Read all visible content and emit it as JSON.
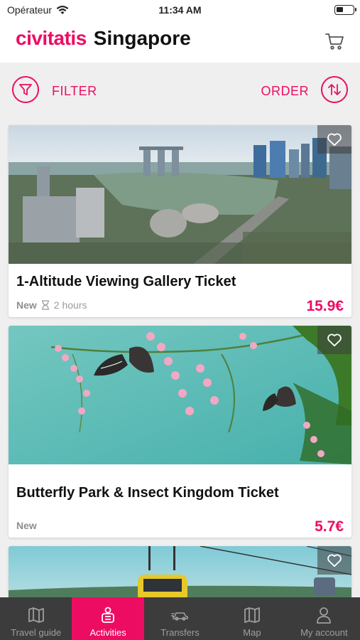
{
  "status_bar": {
    "carrier": "Opérateur",
    "time": "11:34 AM"
  },
  "header": {
    "logo": "civitatis",
    "city": "Singapore"
  },
  "toolbar": {
    "filter_label": "FILTER",
    "order_label": "ORDER"
  },
  "activities": [
    {
      "title": "1-Altitude Viewing Gallery Ticket",
      "badge": "New",
      "duration": "2 hours",
      "price": "15.9€"
    },
    {
      "title": "Butterfly Park & Insect Kingdom Ticket",
      "badge": "New",
      "price": "5.7€"
    }
  ],
  "tabs": [
    {
      "label": "Travel guide",
      "icon": "map-book-icon"
    },
    {
      "label": "Activities",
      "icon": "activities-icon",
      "active": true
    },
    {
      "label": "Transfers",
      "icon": "transfer-car-icon"
    },
    {
      "label": "Map",
      "icon": "map-icon"
    },
    {
      "label": "My account",
      "icon": "user-icon"
    }
  ],
  "colors": {
    "accent": "#ec0d62",
    "tabbar": "#3c3c3c"
  }
}
